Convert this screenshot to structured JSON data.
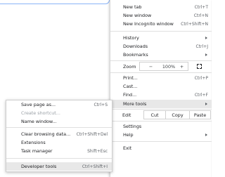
{
  "menu": {
    "new_tab": {
      "label": "New tab",
      "accel": "Ctrl+T"
    },
    "new_window": {
      "label": "New window",
      "accel": "Ctrl+N"
    },
    "new_incognito": {
      "label": "New Incognito window",
      "accel": "Ctrl+Shift+N"
    },
    "history": {
      "label": "History"
    },
    "downloads": {
      "label": "Downloads",
      "accel": "Ctrl+J"
    },
    "bookmarks": {
      "label": "Bookmarks"
    },
    "zoom": {
      "label": "Zoom",
      "minus": "−",
      "value": "100%",
      "plus": "+"
    },
    "print": {
      "label": "Print...",
      "accel": "Ctrl+P"
    },
    "cast": {
      "label": "Cast..."
    },
    "find": {
      "label": "Find...",
      "accel": "Ctrl+F"
    },
    "more_tools": {
      "label": "More tools"
    },
    "edit": {
      "label": "Edit",
      "cut": "Cut",
      "copy": "Copy",
      "paste": "Paste"
    },
    "settings": {
      "label": "Settings"
    },
    "help": {
      "label": "Help"
    },
    "exit": {
      "label": "Exit"
    }
  },
  "submenu": {
    "save_page": {
      "label": "Save page as...",
      "accel": "Ctrl+S"
    },
    "create_shortcut": {
      "label": "Create shortcut..."
    },
    "name_window": {
      "label": "Name window..."
    },
    "clear_browsing": {
      "label": "Clear browsing data...",
      "accel": "Ctrl+Shift+Del"
    },
    "extensions": {
      "label": "Extensions"
    },
    "task_manager": {
      "label": "Task manager",
      "accel": "Shift+Esc"
    },
    "developer_tools": {
      "label": "Developer tools",
      "accel": "Ctrl+Shift+I"
    }
  }
}
